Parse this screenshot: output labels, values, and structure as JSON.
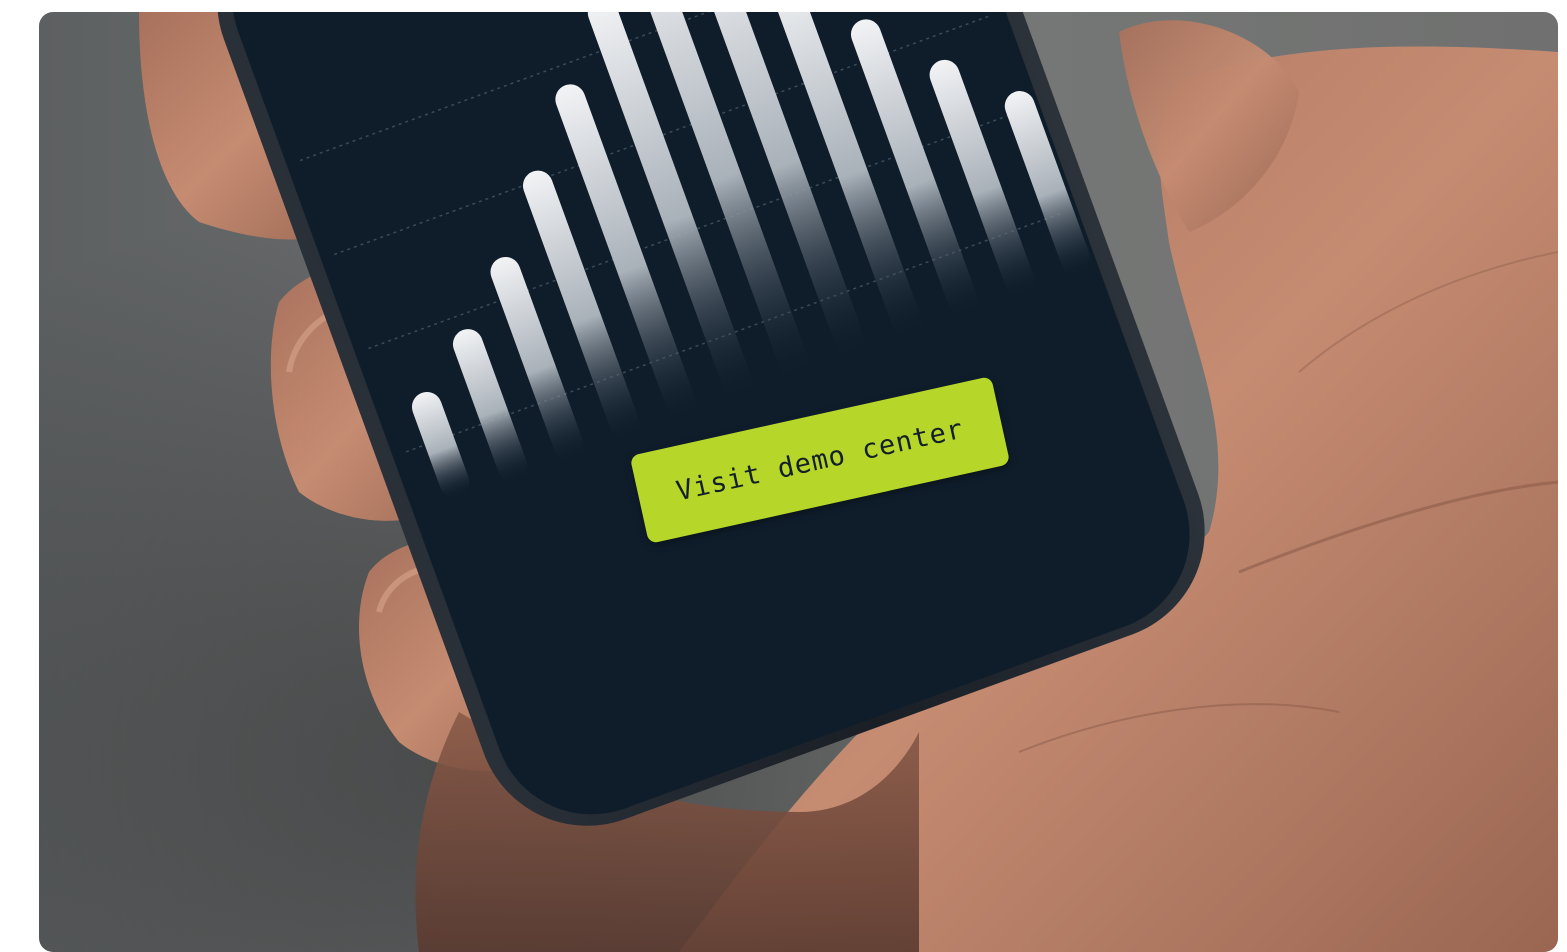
{
  "cta": {
    "label": "Visit demo center"
  },
  "colors": {
    "screen_bg": "#0f1d2b",
    "accent": "#b6d62a",
    "bar_top": "#eef0f2",
    "skin": "#c48a70"
  },
  "icons": {
    "equalizer": "audio-bars-icon"
  }
}
